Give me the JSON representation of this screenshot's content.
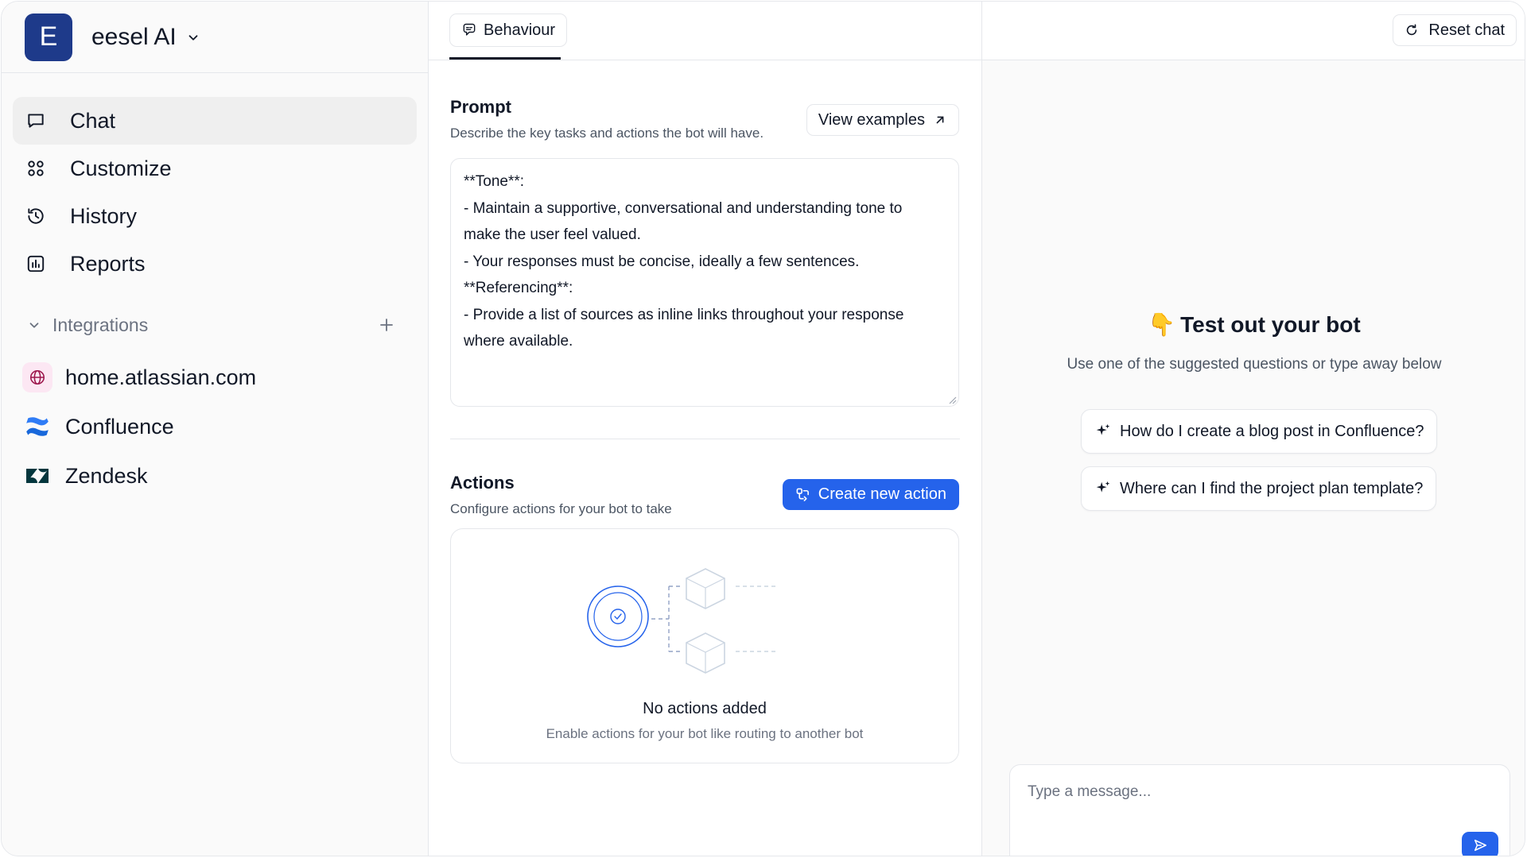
{
  "workspace": {
    "initial": "E",
    "name": "eesel AI"
  },
  "nav": {
    "items": [
      {
        "label": "Chat",
        "icon": "chat-bubble-icon",
        "active": true
      },
      {
        "label": "Customize",
        "icon": "grid-icon"
      },
      {
        "label": "History",
        "icon": "history-icon"
      },
      {
        "label": "Reports",
        "icon": "bar-chart-icon"
      }
    ]
  },
  "integrations": {
    "title": "Integrations",
    "items": [
      {
        "label": "home.atlassian.com",
        "icon": "globe-icon"
      },
      {
        "label": "Confluence",
        "icon": "confluence-logo-icon"
      },
      {
        "label": "Zendesk",
        "icon": "zendesk-logo-icon"
      }
    ]
  },
  "tabs": {
    "behaviour": "Behaviour"
  },
  "prompt": {
    "title": "Prompt",
    "description": "Describe the key tasks and actions the bot will have.",
    "view_examples": "View examples",
    "lines": [
      "**Tone**:",
      "- Maintain a supportive, conversational and understanding tone to",
      "make the user feel valued.",
      "- Your responses must be concise, ideally a few sentences.",
      "",
      "**Referencing**:",
      "- Provide a list of sources as inline links throughout your response",
      "where available."
    ]
  },
  "actions": {
    "title": "Actions",
    "description": "Configure actions for your bot to take",
    "create_button": "Create new action",
    "empty_title": "No actions added",
    "empty_description": "Enable actions for your bot like routing to another bot"
  },
  "test": {
    "reset_button": "Reset chat",
    "hand_emoji": "👇",
    "title": "Test out your bot",
    "description": "Use one of the suggested questions or type away below",
    "suggestions": [
      "How do I create a blog post in Confluence?",
      "Where can I find the project plan template?"
    ],
    "input_placeholder": "Type a message..."
  },
  "colors": {
    "accent": "#2563eb",
    "workspace_avatar": "#1e3a8a",
    "active_nav_bg": "#efefef",
    "confluence_blue": "#1868db",
    "zendesk_dark": "#03363d"
  }
}
